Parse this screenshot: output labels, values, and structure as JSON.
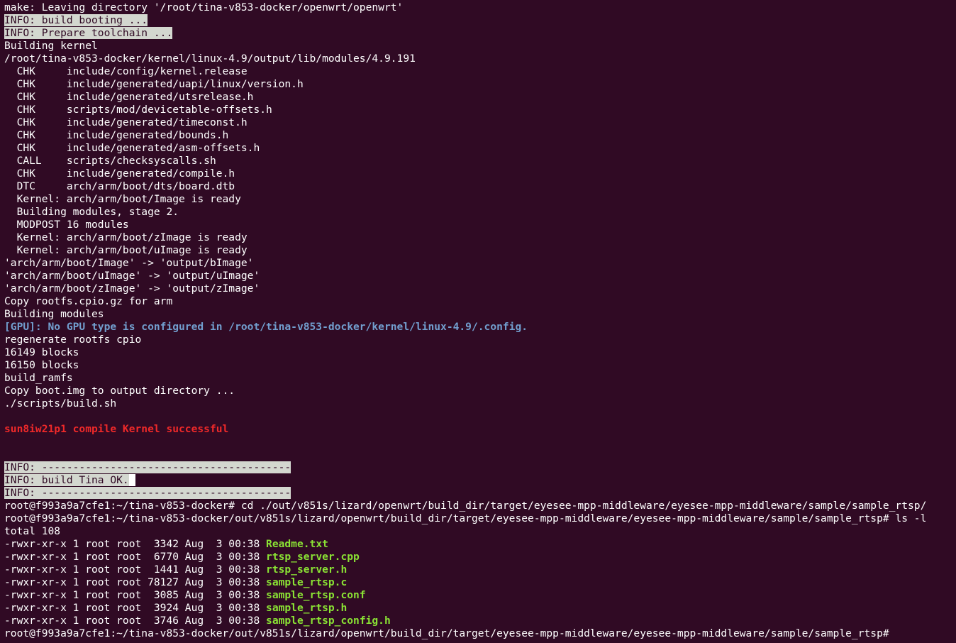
{
  "terminal": {
    "colors": {
      "background": "#300a24",
      "text": "#ffffff",
      "highlight": "#d3d7cf",
      "blue": "#729fcf",
      "red": "#ef2929",
      "green": "#8ae234"
    },
    "lines": [
      [
        {
          "t": "make: Leaving directory '/root/tina-v853-docker/openwrt/openwrt'"
        }
      ],
      [
        {
          "t": "INFO: build booting ...",
          "c": "hl"
        }
      ],
      [
        {
          "t": "INFO: Prepare toolchain ...",
          "c": "hl"
        }
      ],
      [
        {
          "t": "Building kernel"
        }
      ],
      [
        {
          "t": "/root/tina-v853-docker/kernel/linux-4.9/output/lib/modules/4.9.191"
        }
      ],
      [
        {
          "t": "  CHK     include/config/kernel.release"
        }
      ],
      [
        {
          "t": "  CHK     include/generated/uapi/linux/version.h"
        }
      ],
      [
        {
          "t": "  CHK     include/generated/utsrelease.h"
        }
      ],
      [
        {
          "t": "  CHK     scripts/mod/devicetable-offsets.h"
        }
      ],
      [
        {
          "t": "  CHK     include/generated/timeconst.h"
        }
      ],
      [
        {
          "t": "  CHK     include/generated/bounds.h"
        }
      ],
      [
        {
          "t": "  CHK     include/generated/asm-offsets.h"
        }
      ],
      [
        {
          "t": "  CALL    scripts/checksyscalls.sh"
        }
      ],
      [
        {
          "t": "  CHK     include/generated/compile.h"
        }
      ],
      [
        {
          "t": "  DTC     arch/arm/boot/dts/board.dtb"
        }
      ],
      [
        {
          "t": "  Kernel: arch/arm/boot/Image is ready"
        }
      ],
      [
        {
          "t": "  Building modules, stage 2."
        }
      ],
      [
        {
          "t": "  MODPOST 16 modules"
        }
      ],
      [
        {
          "t": "  Kernel: arch/arm/boot/zImage is ready"
        }
      ],
      [
        {
          "t": "  Kernel: arch/arm/boot/uImage is ready"
        }
      ],
      [
        {
          "t": "'arch/arm/boot/Image' -> 'output/bImage'"
        }
      ],
      [
        {
          "t": "'arch/arm/boot/uImage' -> 'output/uImage'"
        }
      ],
      [
        {
          "t": "'arch/arm/boot/zImage' -> 'output/zImage'"
        }
      ],
      [
        {
          "t": "Copy rootfs.cpio.gz for arm"
        }
      ],
      [
        {
          "t": "Building modules"
        }
      ],
      [
        {
          "t": "[GPU]: No GPU type is configured in /root/tina-v853-docker/kernel/linux-4.9/.config.",
          "c": "blue"
        }
      ],
      [
        {
          "t": "regenerate rootfs cpio"
        }
      ],
      [
        {
          "t": "16149 blocks"
        }
      ],
      [
        {
          "t": "16150 blocks"
        }
      ],
      [
        {
          "t": "build_ramfs"
        }
      ],
      [
        {
          "t": "Copy boot.img to output directory ..."
        }
      ],
      [
        {
          "t": "./scripts/build.sh"
        }
      ],
      [
        {
          "t": ""
        }
      ],
      [
        {
          "t": "sun8iw21p1 compile Kernel successful",
          "c": "red"
        }
      ],
      [
        {
          "t": ""
        }
      ],
      [
        {
          "t": ""
        }
      ],
      [
        {
          "t": "INFO: ----------------------------------------",
          "c": "hl"
        }
      ],
      [
        {
          "t": "INFO: build Tina OK.",
          "c": "hl"
        },
        {
          "t": " ",
          "c": "inv"
        }
      ],
      [
        {
          "t": "INFO: ----------------------------------------",
          "c": "hl"
        }
      ],
      [
        {
          "t": "root@f993a9a7cfe1:~/tina-v853-docker# cd ./out/v851s/lizard/openwrt/build_dir/target/eyesee-mpp-middleware/eyesee-mpp-middleware/sample/sample_rtsp/"
        }
      ],
      [
        {
          "t": "root@f993a9a7cfe1:~/tina-v853-docker/out/v851s/lizard/openwrt/build_dir/target/eyesee-mpp-middleware/eyesee-mpp-middleware/sample/sample_rtsp# ls -l"
        }
      ],
      [
        {
          "t": "total 108"
        }
      ],
      [
        {
          "t": "-rwxr-xr-x 1 root root  3342 Aug  3 00:38 "
        },
        {
          "t": "Readme.txt",
          "c": "green"
        }
      ],
      [
        {
          "t": "-rwxr-xr-x 1 root root  6770 Aug  3 00:38 "
        },
        {
          "t": "rtsp_server.cpp",
          "c": "green"
        }
      ],
      [
        {
          "t": "-rwxr-xr-x 1 root root  1441 Aug  3 00:38 "
        },
        {
          "t": "rtsp_server.h",
          "c": "green"
        }
      ],
      [
        {
          "t": "-rwxr-xr-x 1 root root 78127 Aug  3 00:38 "
        },
        {
          "t": "sample_rtsp.c",
          "c": "green"
        }
      ],
      [
        {
          "t": "-rwxr-xr-x 1 root root  3085 Aug  3 00:38 "
        },
        {
          "t": "sample_rtsp.conf",
          "c": "green"
        }
      ],
      [
        {
          "t": "-rwxr-xr-x 1 root root  3924 Aug  3 00:38 "
        },
        {
          "t": "sample_rtsp.h",
          "c": "green"
        }
      ],
      [
        {
          "t": "-rwxr-xr-x 1 root root  3746 Aug  3 00:38 "
        },
        {
          "t": "sample_rtsp_config.h",
          "c": "green"
        }
      ],
      [
        {
          "t": "root@f993a9a7cfe1:~/tina-v853-docker/out/v851s/lizard/openwrt/build_dir/target/eyesee-mpp-middleware/eyesee-mpp-middleware/sample/sample_rtsp# "
        }
      ]
    ]
  }
}
